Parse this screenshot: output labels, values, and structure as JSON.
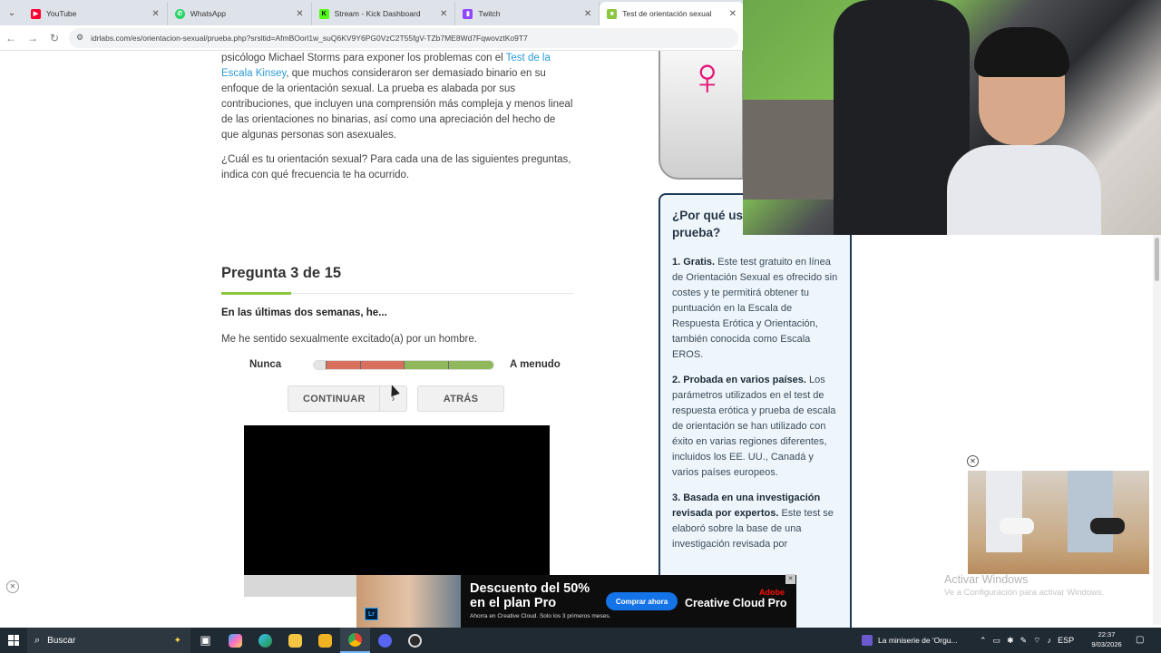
{
  "browser": {
    "tabs": [
      {
        "title": "YouTube",
        "icon": "youtube-icon",
        "color": "#ff0033",
        "active": false
      },
      {
        "title": "WhatsApp",
        "icon": "whatsapp-icon",
        "color": "#25d366",
        "active": false
      },
      {
        "title": "Stream - Kick Dashboard",
        "icon": "kick-icon",
        "color": "#53fc18",
        "active": false
      },
      {
        "title": "Twitch",
        "icon": "twitch-icon",
        "color": "#9146ff",
        "active": false
      },
      {
        "title": "Test de orientación sexual",
        "icon": "site-icon",
        "color": "#8cc63f",
        "active": true
      }
    ],
    "url": "idrlabs.com/es/orientacion-sexual/prueba.php?srsltid=AfmBOorl1w_suQ6KV9Y6PG0VzC2T55fgV-TZb7ME8Wd7FqwovztKo9T7"
  },
  "article": {
    "p1_pre": "psicólogo Michael Storms para exponer los problemas con el ",
    "p1_link": "Test de la Escala Kinsey",
    "p1_post": ", que muchos consideraron ser demasiado binario en su enfoque de la orientación sexual. La prueba es alabada por sus contribuciones, que incluyen una comprensión más compleja y menos lineal de las orientaciones no binarias, así como una apreciación del hecho de que algunas personas son asexuales.",
    "p2": "¿Cuál es tu orientación sexual? Para cada una de las siguientes preguntas, indica con qué frecuencia te ha ocurrido."
  },
  "question": {
    "title": "Pregunta 3 de 15",
    "lead": "En las últimas dos semanas, he...",
    "text": "Me he sentido sexualmente excitado(a) por un hombre.",
    "scale_low": "Nunca",
    "scale_high": "A menudo",
    "scale_colors": [
      "#e4e4e4",
      "#d9705e",
      "#d9705e",
      "#8fb85a",
      "#8fb85a"
    ],
    "continue_label": "CONTINUAR",
    "back_label": "ATRÁS"
  },
  "sidebar": {
    "title": "¿Por qué us prueba?",
    "items": [
      {
        "head": "1. Gratis.",
        "body": " Este test gratuito en línea de Orientación Sexual es ofrecido sin costes y te permitirá obtener tu puntuación en la Escala de Respuesta Erótica y Orientación, también conocida como Escala EROS."
      },
      {
        "head": "2. Probada en varios países.",
        "body": " Los parámetros utilizados en el test de respuesta erótica y prueba de escala de orientación se han utilizado con éxito en varias regiones diferentes, incluidos los EE. UU., Canadá y varios países europeos."
      },
      {
        "head": "3. Basada en una investigación revisada por expertos.",
        "body": " Este test se elaboró sobre la base de una investigación revisada por"
      }
    ]
  },
  "windows_activation": {
    "line1": "Activar Windows",
    "line2": "Ve a Configuración para activar Windows."
  },
  "adobe_ad": {
    "headline": "Descuento del 50% en el plan Pro",
    "sub": "Ahorra en Creative Cloud. Solo los 3 primeros meses.",
    "cta": "Comprar ahora",
    "brand": "Adobe",
    "product": "Creative Cloud Pro",
    "badge": "Lr"
  },
  "taskbar": {
    "search_label": "Buscar",
    "now_playing": "La miniserie de 'Orgu...",
    "lang": "ESP",
    "time": "22:37",
    "date": "9/03/2026"
  }
}
